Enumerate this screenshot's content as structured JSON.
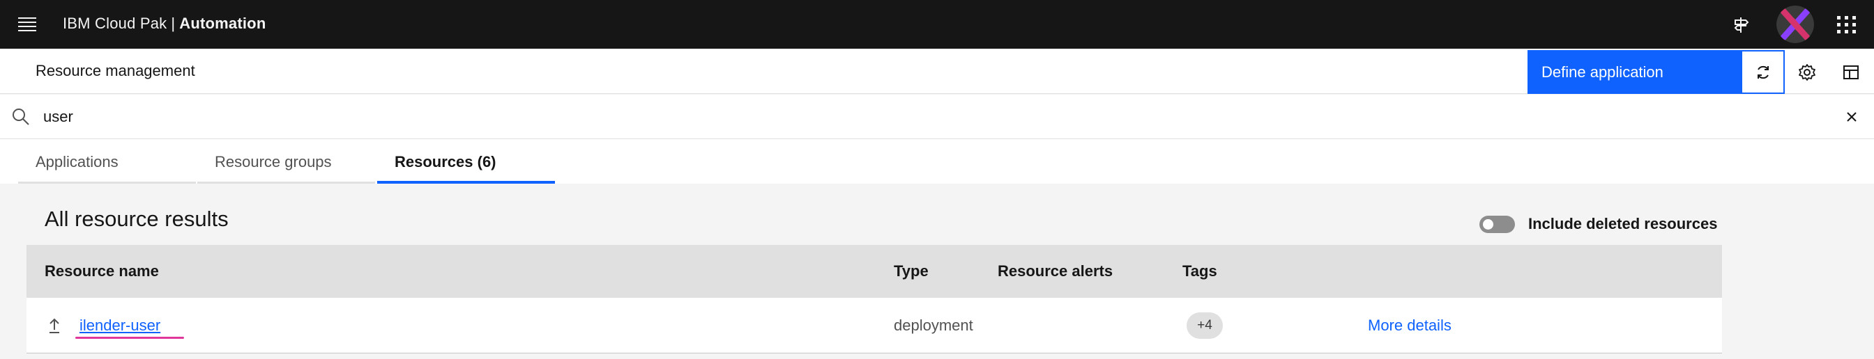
{
  "header": {
    "brand_prefix": "IBM Cloud Pak",
    "brand_separator": "|",
    "brand_product": "Automation",
    "icons": [
      "menu-icon",
      "signpost-icon",
      "avatar",
      "app-switcher-icon"
    ]
  },
  "toolbar": {
    "page_title": "Resource management",
    "primary_action": "Define application",
    "icons": [
      "refresh-icon",
      "settings-icon",
      "layout-icon"
    ]
  },
  "search": {
    "value": "user",
    "placeholder": "Search"
  },
  "tabs": [
    {
      "label": "Applications",
      "active": false
    },
    {
      "label": "Resource groups",
      "active": false
    },
    {
      "label": "Resources (6)",
      "active": true
    }
  ],
  "results": {
    "title": "All resource results",
    "toggle_label": "Include deleted resources",
    "toggle_on": false
  },
  "table": {
    "columns": [
      "Resource name",
      "Type",
      "Resource alerts",
      "Tags"
    ],
    "rows": [
      {
        "name": "ilender-user",
        "type": "deployment",
        "alerts": "",
        "tags": "+4",
        "action": "More details"
      }
    ]
  },
  "colors": {
    "header_bg": "#161616",
    "primary": "#0f62fe",
    "highlight": "#e0389a",
    "content_bg": "#f4f4f4"
  }
}
